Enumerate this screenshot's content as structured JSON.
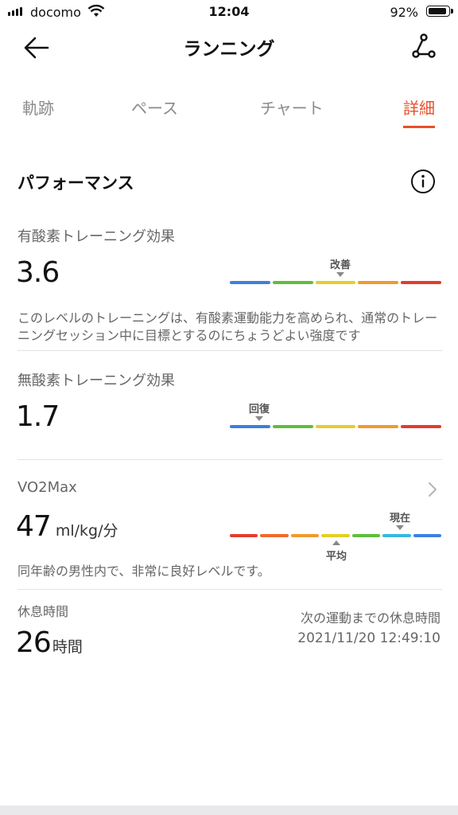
{
  "status_bar": {
    "carrier": "docomo",
    "time": "12:04",
    "battery_pct": "92%",
    "battery_level": 0.92
  },
  "header": {
    "title": "ランニング",
    "back_icon": "arrow-left-icon",
    "route_icon": "route-share-icon"
  },
  "tabs": [
    {
      "label": "軌跡",
      "active": false
    },
    {
      "label": "ペース",
      "active": false
    },
    {
      "label": "チャート",
      "active": false
    },
    {
      "label": "詳細",
      "active": true
    }
  ],
  "performance": {
    "title": "パフォーマンス",
    "info_icon": "info-icon",
    "aerobic": {
      "label": "有酸素トレーニング効果",
      "value": "3.6",
      "marker_label": "改善",
      "scale_colors": [
        "#3d7fe0",
        "#5fbf3a",
        "#e3cf2a",
        "#f09a2e",
        "#e33c2f"
      ],
      "description": "このレベルのトレーニングは、有酸素運動能力を高められ、通常のトレーニングセッション中に目標とするのにちょうどよい強度です"
    },
    "anaerobic": {
      "label": "無酸素トレーニング効果",
      "value": "1.7",
      "marker_label": "回復",
      "scale_colors": [
        "#3d7fe0",
        "#5fbf3a",
        "#e3cf2a",
        "#f09a2e",
        "#e33c2f"
      ]
    },
    "vo2max": {
      "label": "VO2Max",
      "value": "47",
      "unit": "ml/kg/分",
      "current_label": "現在",
      "average_label": "平均",
      "scale_colors": [
        "#e33c2f",
        "#ef6a2e",
        "#f09a2e",
        "#e3cf2a",
        "#5fbf3a",
        "#37b8e0",
        "#3d7fe0"
      ],
      "description": "同年齢の男性内で、非常に良好レベルです。"
    },
    "rest": {
      "label": "休息時間",
      "value": "26",
      "unit": "時間",
      "next_label": "次の運動までの休息時間",
      "next_time": "2021/11/20 12:49:10"
    }
  }
}
